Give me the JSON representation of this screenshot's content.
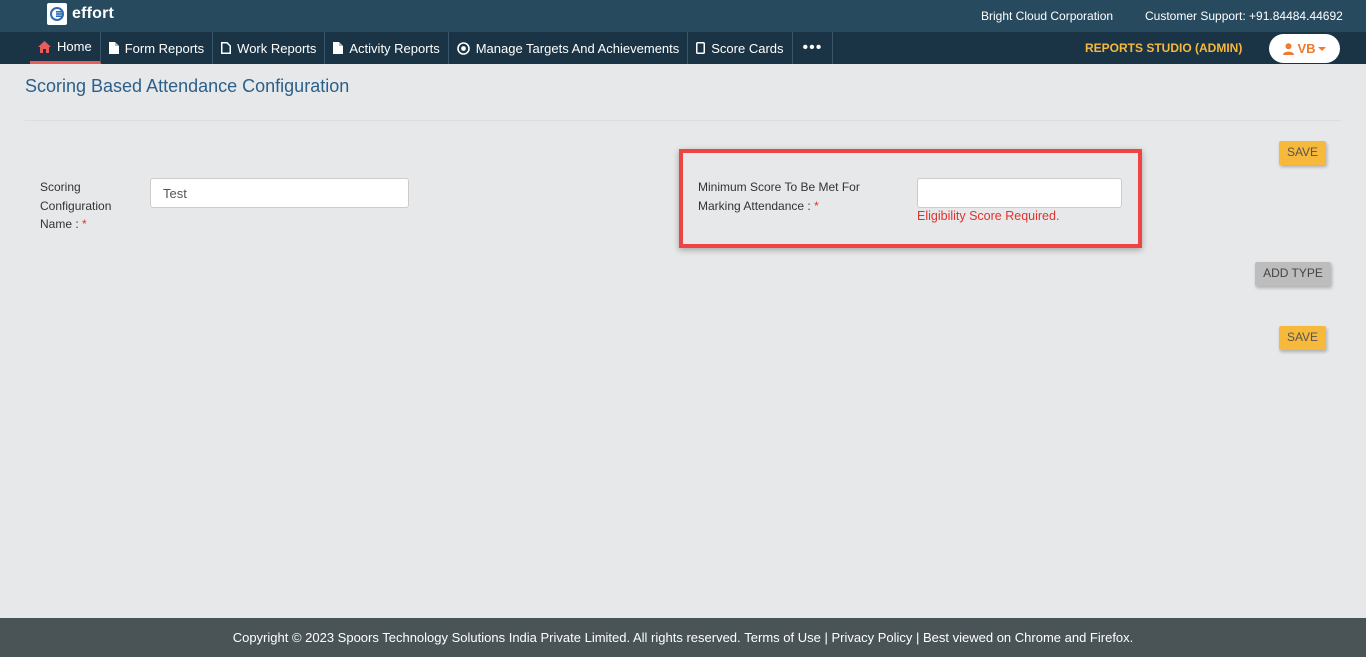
{
  "header": {
    "logo_text": "effort",
    "company": "Bright Cloud Corporation",
    "support": "Customer Support: +91.84484.44692"
  },
  "nav": {
    "items": [
      {
        "label": "Home",
        "icon": "home-icon"
      },
      {
        "label": "Form Reports",
        "icon": "file-icon"
      },
      {
        "label": "Work Reports",
        "icon": "file-outline-icon"
      },
      {
        "label": "Activity Reports",
        "icon": "file-icon"
      },
      {
        "label": "Manage Targets And Achievements",
        "icon": "target-icon"
      },
      {
        "label": "Score Cards",
        "icon": "tablet-icon"
      }
    ],
    "more": "•••",
    "studio": "REPORTS STUDIO (ADMIN)",
    "user_initials": "VB",
    "accent": "#f6b93b"
  },
  "page": {
    "title": "Scoring Based Attendance Configuration",
    "save_top": "SAVE",
    "save_bottom": "SAVE",
    "add_type": "ADD TYPE",
    "config_name_label": "Scoring Configuration Name :",
    "config_name_value": "Test",
    "required_mark": "*",
    "min_score_label": "Minimum Score To Be Met For Marking Attendance :",
    "min_score_value": "",
    "min_score_error": "Eligibility Score Required."
  },
  "footer": {
    "copyright": "Copyright © 2023 Spoors Technology Solutions India Private Limited. All rights reserved.",
    "terms": "Terms of Use",
    "privacy": "Privacy Policy",
    "browsers": "Best viewed on Chrome and Firefox."
  }
}
